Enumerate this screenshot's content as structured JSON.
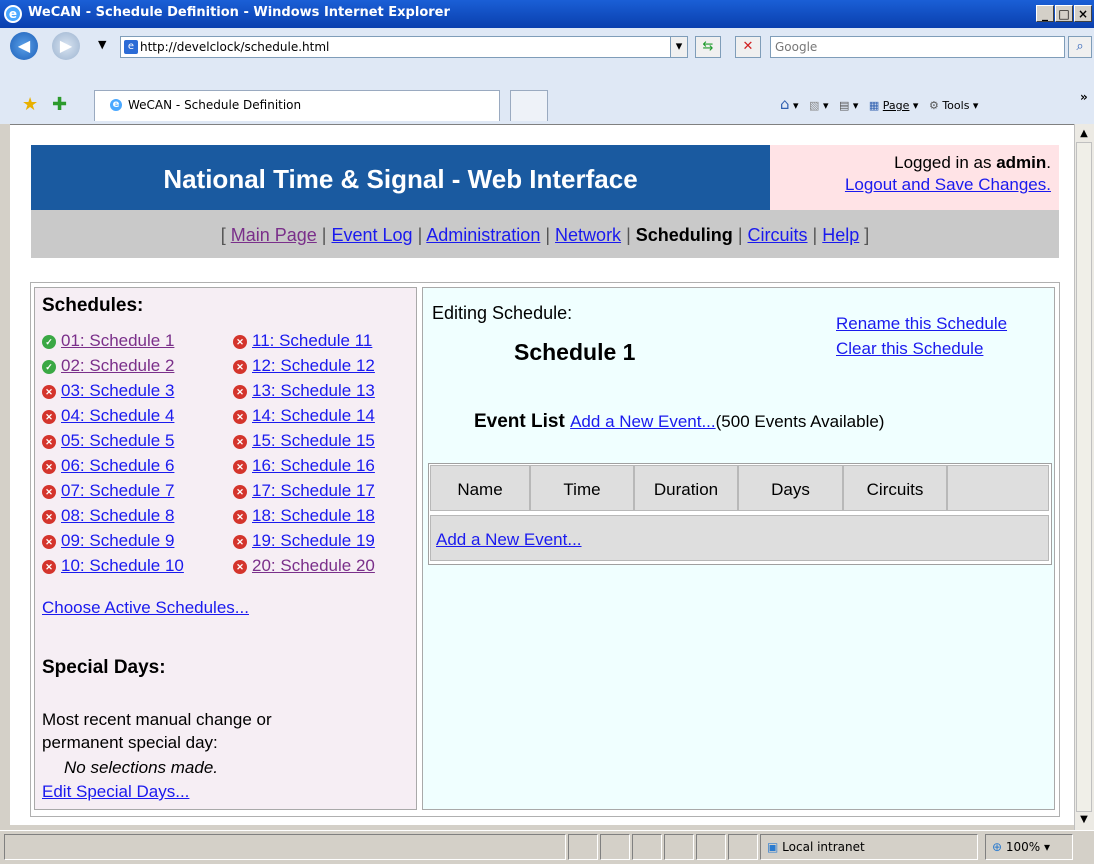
{
  "window": {
    "title": "WeCAN - Schedule Definition - Windows Internet Explorer",
    "minimize": "_",
    "maximize": "□",
    "close": "×"
  },
  "browser": {
    "url": "http://develclock/schedule.html",
    "search_placeholder": "Google",
    "tab_title": "WeCAN - Schedule Definition",
    "cmd_page": "Page",
    "cmd_tools": "Tools",
    "status_zone": "Local intranet",
    "zoom": "100%"
  },
  "header": {
    "title": "National Time & Signal - Web Interface",
    "login_prefix": "Logged in as ",
    "login_user": "admin",
    "login_suffix": ".",
    "logout": "Logout and Save Changes."
  },
  "nav": {
    "open_bracket": "[",
    "close_bracket": "]",
    "sep": "|",
    "items": [
      {
        "label": "Main Page"
      },
      {
        "label": "Event Log"
      },
      {
        "label": "Administration"
      },
      {
        "label": "Network"
      },
      {
        "label": "Scheduling"
      },
      {
        "label": "Circuits"
      },
      {
        "label": "Help"
      }
    ]
  },
  "sidebar": {
    "schedules_heading": "Schedules:",
    "schedules": [
      {
        "label": "01: Schedule 1",
        "status": "active"
      },
      {
        "label": "02: Schedule 2",
        "status": "active"
      },
      {
        "label": "03: Schedule 3",
        "status": "inactive"
      },
      {
        "label": "04: Schedule 4",
        "status": "inactive"
      },
      {
        "label": "05: Schedule 5",
        "status": "inactive"
      },
      {
        "label": "06: Schedule 6",
        "status": "inactive"
      },
      {
        "label": "07: Schedule 7",
        "status": "inactive"
      },
      {
        "label": "08: Schedule 8",
        "status": "inactive"
      },
      {
        "label": "09: Schedule 9",
        "status": "inactive"
      },
      {
        "label": "10: Schedule 10",
        "status": "inactive"
      },
      {
        "label": "11: Schedule 11",
        "status": "inactive"
      },
      {
        "label": "12: Schedule 12",
        "status": "inactive"
      },
      {
        "label": "13: Schedule 13",
        "status": "inactive"
      },
      {
        "label": "14: Schedule 14",
        "status": "inactive"
      },
      {
        "label": "15: Schedule 15",
        "status": "inactive"
      },
      {
        "label": "16: Schedule 16",
        "status": "inactive"
      },
      {
        "label": "17: Schedule 17",
        "status": "inactive"
      },
      {
        "label": "18: Schedule 18",
        "status": "inactive"
      },
      {
        "label": "19: Schedule 19",
        "status": "inactive"
      },
      {
        "label": "20: Schedule 20",
        "status": "inactive"
      }
    ],
    "choose_active": "Choose Active Schedules...",
    "special_heading": "Special Days:",
    "special_text_1": "Most recent manual change or",
    "special_text_2": "permanent special day:",
    "no_selections": "No selections made.",
    "edit_special": "Edit Special Days..."
  },
  "main": {
    "editing_label": "Editing Schedule:",
    "schedule_name": "Schedule 1",
    "rename": "Rename this Schedule",
    "clear": "Clear this Schedule",
    "event_list": "Event List",
    "add_event_link": "Add a New Event...",
    "events_available": "(500 Events Available)",
    "columns": [
      "Name",
      "Time",
      "Duration",
      "Days",
      "Circuits",
      ""
    ],
    "add_event_row": "Add a New Event..."
  },
  "colors": {
    "header_bg": "#1a5aa0",
    "login_bg": "#ffe3e6",
    "nav_bg": "#c9c9c9",
    "sidebar_bg": "#f6eef4",
    "main_bg": "#f0ffff",
    "active_icon": "#3aa844",
    "inactive_icon": "#d4342c"
  },
  "icons": {
    "active": "check-circle-icon",
    "inactive": "x-circle-icon"
  }
}
